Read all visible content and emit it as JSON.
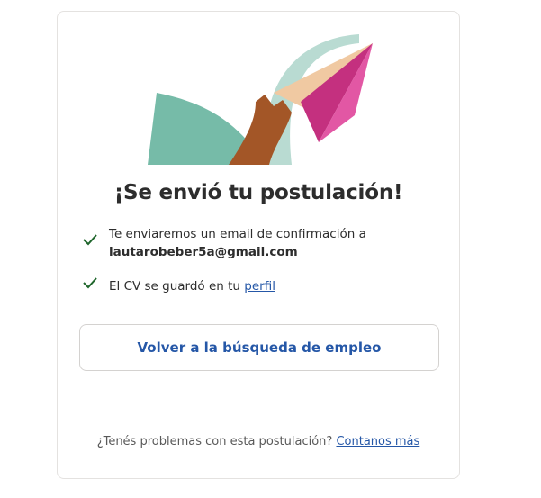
{
  "title": "¡Se envió tu postulación!",
  "confirmation": {
    "text": "Te enviaremos un email de confirmación a",
    "email": "lautarobeber5a@gmail.com"
  },
  "cv": {
    "text": "El CV se guardó en tu",
    "link": "perfil"
  },
  "back_button": "Volver a la búsqueda de empleo",
  "footer": {
    "question": "¿Tenés problemas con esta postulación?",
    "link": "Contanos más"
  },
  "icons": {
    "check": "check-icon",
    "illustration": "paper-plane-illustration"
  },
  "colors": {
    "accent": "#2557a7",
    "check": "#1f662c"
  }
}
